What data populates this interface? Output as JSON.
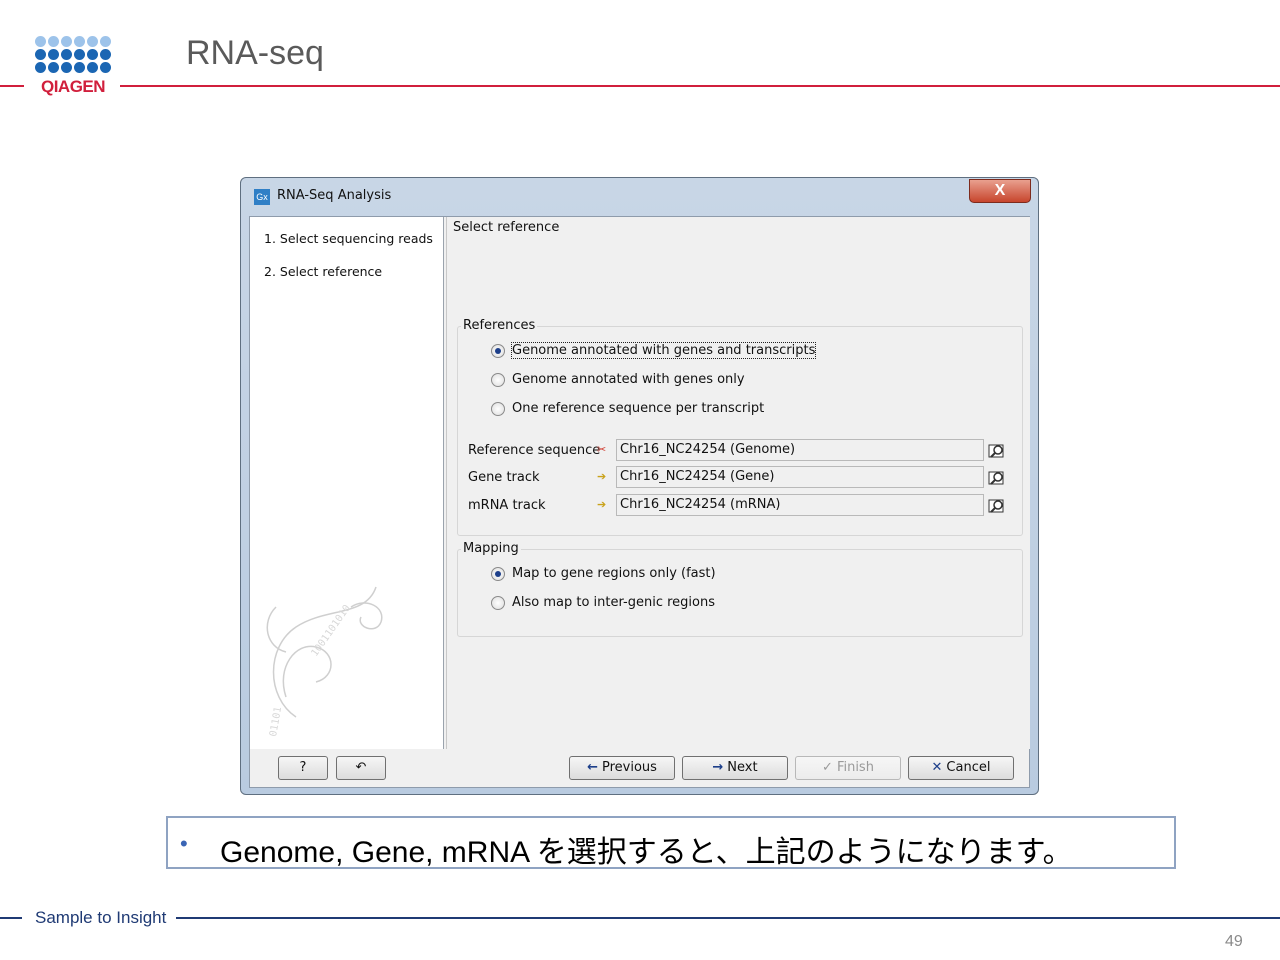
{
  "slide": {
    "title": "RNA-seq",
    "logo_text": "QIAGEN",
    "footer": "Sample to Insight",
    "page_number": "49",
    "caption": "Genome, Gene, mRNA を選択すると、上記のようになります。",
    "colors": {
      "brand_red": "#d11f3c",
      "brand_blue": "#1f3a74",
      "logo_dot_light": "#9dc3ea",
      "logo_dot_dark": "#1b66b3"
    }
  },
  "window": {
    "icon_text": "Gx",
    "title": "RNA-Seq Analysis",
    "close_label": "X",
    "steps": [
      {
        "label": "1.  Select sequencing reads"
      },
      {
        "label": "2.  Select reference"
      }
    ],
    "panel_title": "Select reference",
    "references": {
      "group_label": "References",
      "options": [
        {
          "label": "Genome annotated with genes and transcripts",
          "checked": true
        },
        {
          "label": "Genome annotated with genes only",
          "checked": false
        },
        {
          "label": "One reference sequence per transcript",
          "checked": false
        }
      ],
      "fields": [
        {
          "label": "Reference sequence",
          "value": "Chr16_NC24254 (Genome)",
          "icon": "sequence-icon"
        },
        {
          "label": "Gene track",
          "value": "Chr16_NC24254 (Gene)",
          "icon": "track-icon"
        },
        {
          "label": "mRNA track",
          "value": "Chr16_NC24254 (mRNA)",
          "icon": "track-icon"
        }
      ]
    },
    "mapping": {
      "group_label": "Mapping",
      "options": [
        {
          "label": "Map to gene regions only (fast)",
          "checked": true
        },
        {
          "label": "Also map to inter-genic regions",
          "checked": false
        }
      ]
    },
    "buttons": {
      "help": "?",
      "reset": "↶",
      "previous": "Previous",
      "next": "Next",
      "finish": "Finish",
      "cancel": "Cancel"
    }
  }
}
